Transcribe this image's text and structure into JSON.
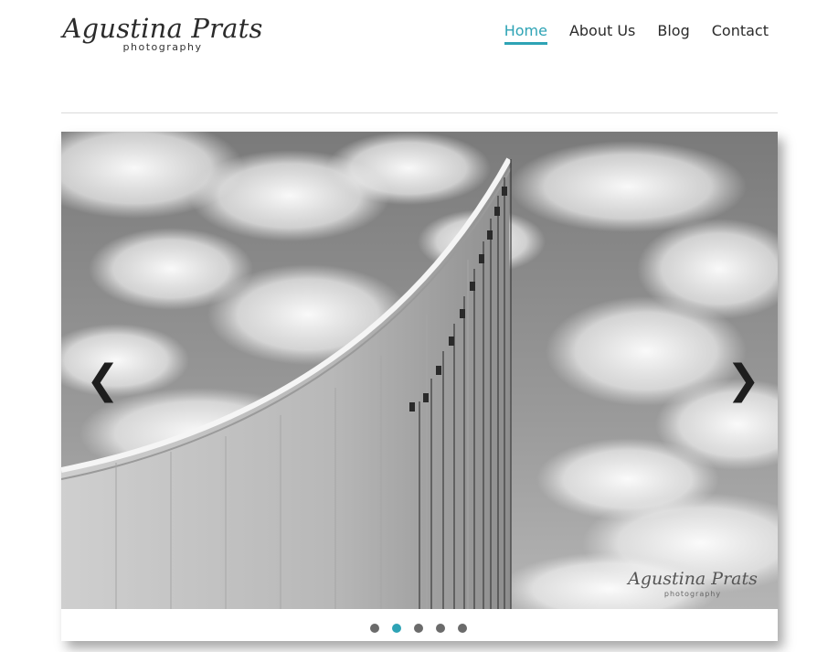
{
  "brand": {
    "name": "Agustina Prats",
    "tagline": "photography"
  },
  "nav": {
    "items": [
      {
        "label": "Home",
        "active": true
      },
      {
        "label": "About Us",
        "active": false
      },
      {
        "label": "Blog",
        "active": false
      },
      {
        "label": "Contact",
        "active": false
      }
    ]
  },
  "slider": {
    "prev_label": "❮",
    "next_label": "❯",
    "watermark": {
      "name": "Agustina Prats",
      "tagline": "photography"
    },
    "slide_count": 5,
    "active_index": 1
  },
  "colors": {
    "accent": "#2ea3b5",
    "text": "#2b2b2b",
    "dot_inactive": "#6b6b6b"
  }
}
